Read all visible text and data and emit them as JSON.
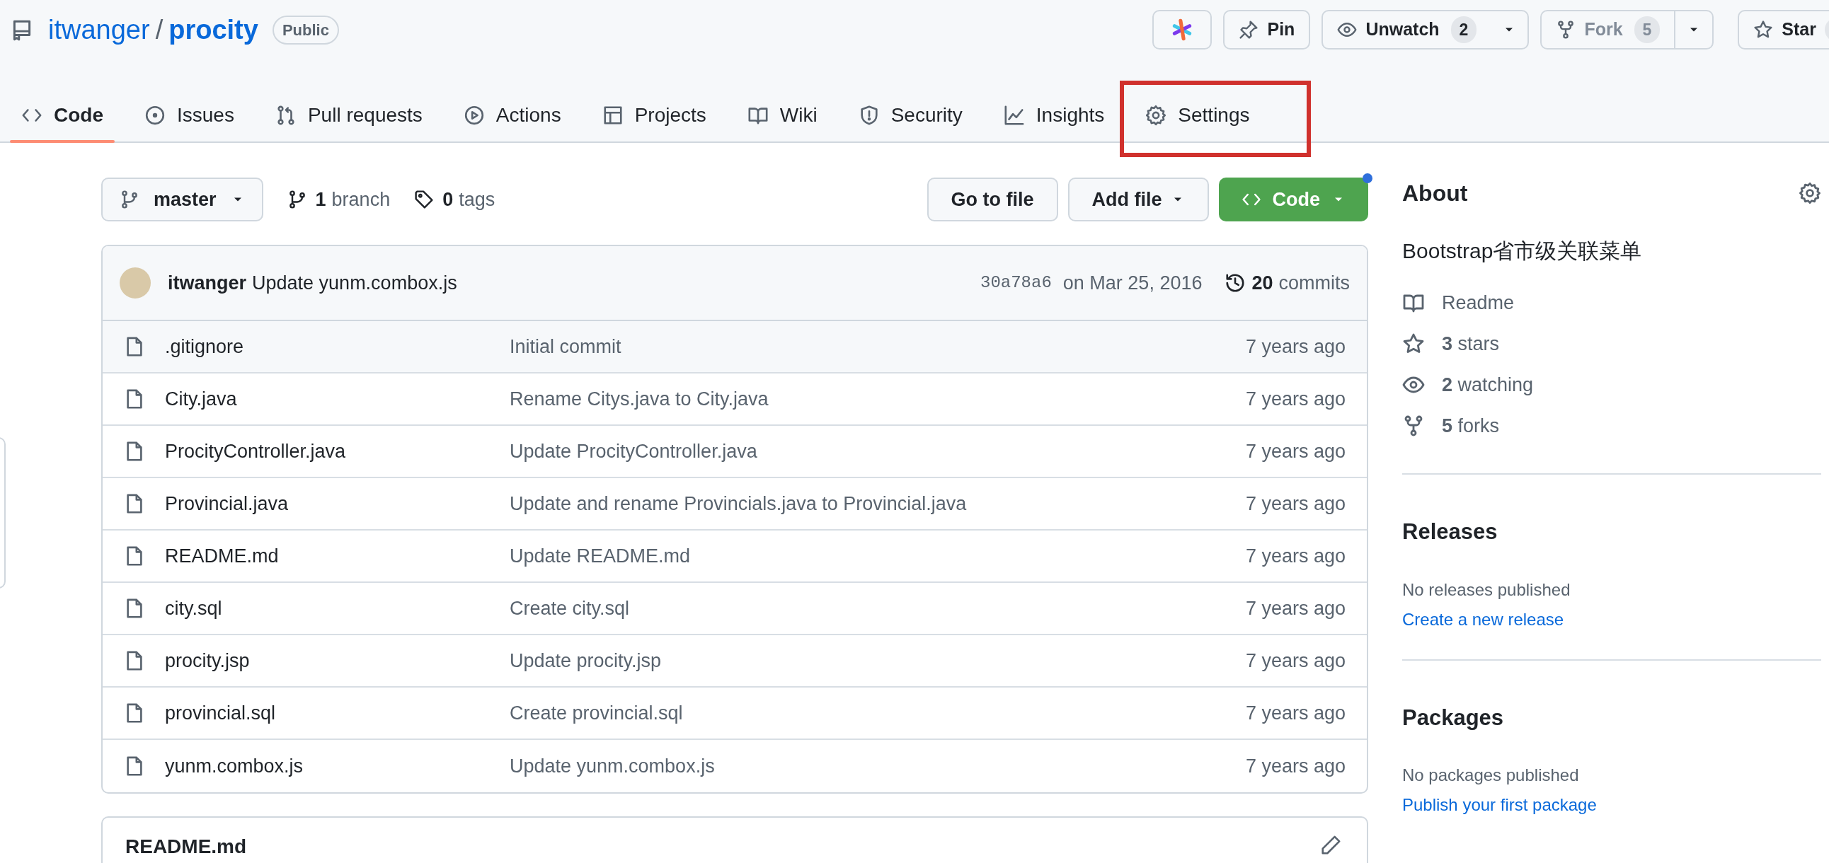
{
  "repo": {
    "owner": "itwanger",
    "separator": "/",
    "name": "procity",
    "visibility": "Public"
  },
  "actions": [
    {
      "kind": "app",
      "disabled": false
    },
    {
      "kind": "pin",
      "label": "Pin",
      "disabled": false
    },
    {
      "kind": "watch",
      "label": "Unwatch",
      "count": "2",
      "disabled": false
    },
    {
      "kind": "fork",
      "label": "Fork",
      "count": "5",
      "disabled": true
    },
    {
      "kind": "star",
      "label": "Star",
      "disabled": false
    }
  ],
  "tabs": [
    {
      "label": "Code",
      "selected": true,
      "annotated": false
    },
    {
      "label": "Issues",
      "selected": false,
      "annotated": false
    },
    {
      "label": "Pull requests",
      "selected": false,
      "annotated": false
    },
    {
      "label": "Actions",
      "selected": false,
      "annotated": false
    },
    {
      "label": "Projects",
      "selected": false,
      "annotated": false
    },
    {
      "label": "Wiki",
      "selected": false,
      "annotated": false
    },
    {
      "label": "Security",
      "selected": false,
      "annotated": false
    },
    {
      "label": "Insights",
      "selected": false,
      "annotated": false
    },
    {
      "label": "Settings",
      "selected": false,
      "annotated": true
    }
  ],
  "toolbar": {
    "branch": "master",
    "branches_count": "1",
    "branches_label": "branch",
    "tags_count": "0",
    "tags_label": "tags",
    "buttons": [
      "Go to file",
      "Add file"
    ],
    "code_button": "Code"
  },
  "commit": {
    "author": "itwanger",
    "message": "Update yunm.combox.js",
    "sha": "30a78a6",
    "date": "on Mar 25, 2016",
    "commits_count": "20",
    "commits_label": "commits"
  },
  "files": [
    {
      "name": ".gitignore",
      "message": "Initial commit",
      "age": "7 years ago"
    },
    {
      "name": "City.java",
      "message": "Rename Citys.java to City.java",
      "age": "7 years ago"
    },
    {
      "name": "ProcityController.java",
      "message": "Update ProcityController.java",
      "age": "7 years ago"
    },
    {
      "name": "Provincial.java",
      "message": "Update and rename Provincials.java to Provincial.java",
      "age": "7 years ago"
    },
    {
      "name": "README.md",
      "message": "Update README.md",
      "age": "7 years ago"
    },
    {
      "name": "city.sql",
      "message": "Create city.sql",
      "age": "7 years ago"
    },
    {
      "name": "procity.jsp",
      "message": "Update procity.jsp",
      "age": "7 years ago"
    },
    {
      "name": "provincial.sql",
      "message": "Create provincial.sql",
      "age": "7 years ago"
    },
    {
      "name": "yunm.combox.js",
      "message": "Update yunm.combox.js",
      "age": "7 years ago"
    }
  ],
  "readme": {
    "title": "README.md"
  },
  "sidebar": {
    "about": {
      "title": "About",
      "description": "Bootstrap省市级关联菜单",
      "links": [
        "Readme",
        "**3** stars",
        "**2** watching",
        "**5** forks"
      ]
    },
    "sections": [
      {
        "title": "Releases",
        "text": "No releases published",
        "link": "Create a new release"
      },
      {
        "title": "Packages",
        "text": "No packages published",
        "link": "Publish your first package"
      }
    ]
  }
}
